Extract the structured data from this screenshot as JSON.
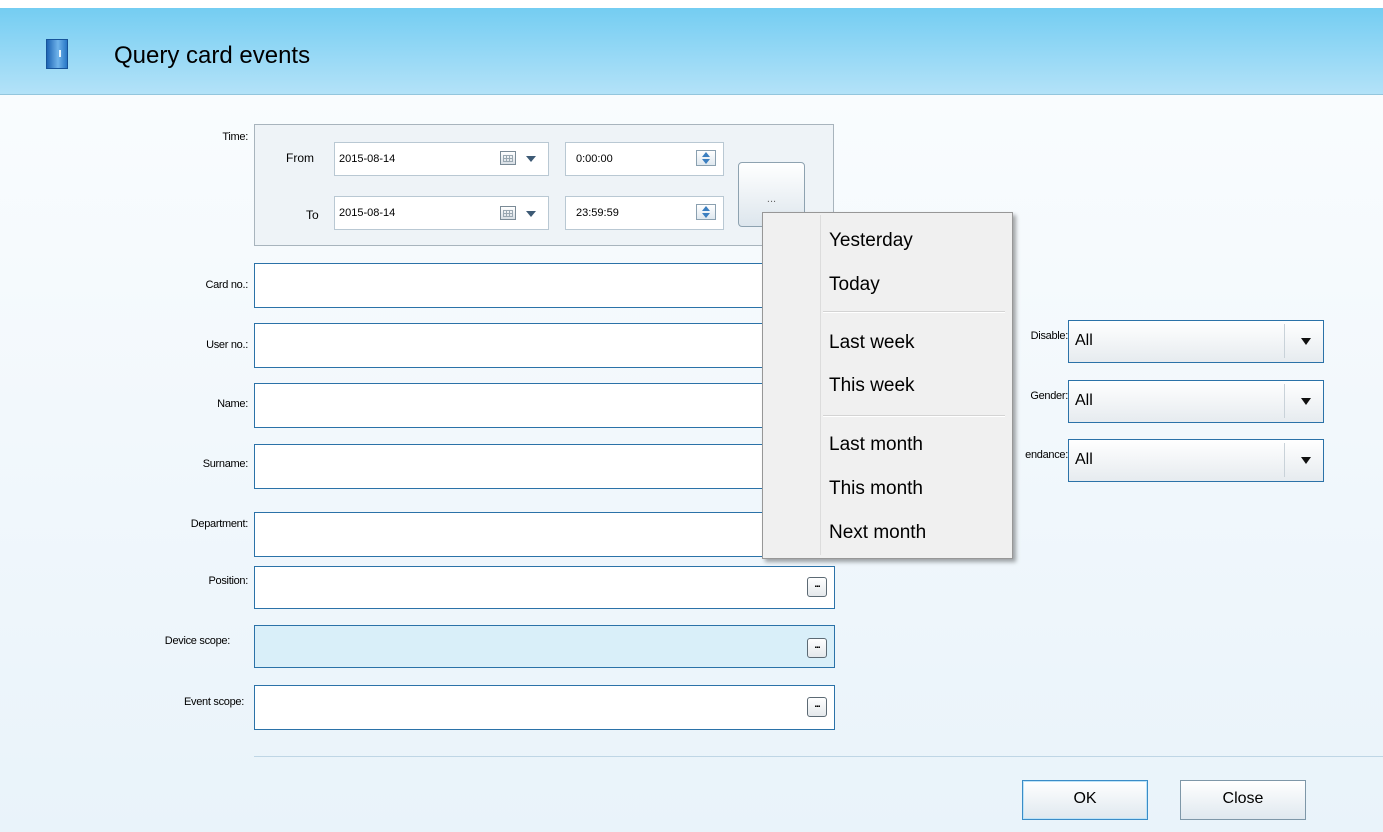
{
  "window": {
    "title": "Query card events",
    "icon": "door-icon"
  },
  "time": {
    "label": "Time:",
    "from_label": "From",
    "to_label": "To",
    "from_date": "2015-08-14",
    "from_time": "0:00:00",
    "to_date": "2015-08-14",
    "to_time": "23:59:59",
    "preset_button": "..."
  },
  "fields": {
    "card_no": "Card no.:",
    "user_no": "User no.:",
    "name": "Name:",
    "surname": "Surname:",
    "department": "Department:",
    "position": "Position:",
    "device_scope": "Device scope:",
    "event_scope": "Event scope:",
    "ellipsis": "..."
  },
  "filters": {
    "disable_label": "Disable:",
    "disable_value": "All",
    "gender_label": "Gender:",
    "gender_value": "All",
    "attendance_label": "endance:",
    "attendance_value": "All"
  },
  "menu": {
    "yesterday": "Yesterday",
    "today": "Today",
    "last_week": "Last week",
    "this_week": "This week",
    "last_month": "Last month",
    "this_month": "This month",
    "next_month": "Next month"
  },
  "buttons": {
    "ok": "OK",
    "close": "Close"
  },
  "colors": {
    "titlebar": "#74cdf2",
    "field_border": "#2b72a8",
    "shaded_field": "#d9eff9"
  }
}
